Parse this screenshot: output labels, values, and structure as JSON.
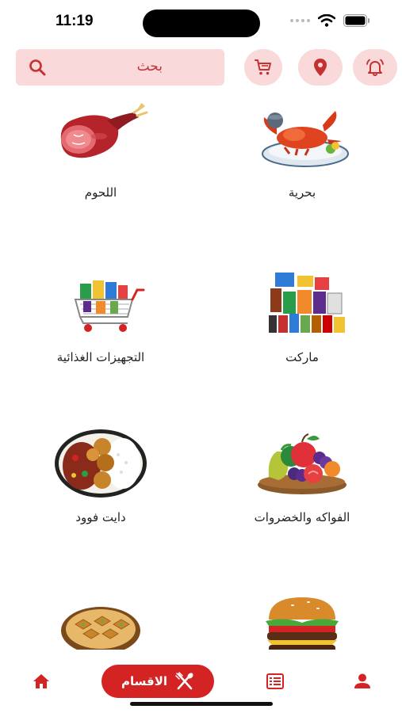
{
  "status_bar": {
    "time": "11:19"
  },
  "header": {
    "search_placeholder": "بحث",
    "icons": [
      "bell-icon",
      "location-pin-icon",
      "cart-icon",
      "search-icon"
    ]
  },
  "categories": [
    {
      "label": "بحرية",
      "icon": "seafood-image"
    },
    {
      "label": "اللحوم",
      "icon": "meat-image"
    },
    {
      "label": "ماركت",
      "icon": "market-image"
    },
    {
      "label": "التجهيزات الغذائية",
      "icon": "food-supplies-image"
    },
    {
      "label": "الفواكه والخضروات",
      "icon": "fruits-vegetables-image"
    },
    {
      "label": "دايت فوود",
      "icon": "diet-food-image"
    },
    {
      "label": "",
      "icon": "burger-image"
    },
    {
      "label": "",
      "icon": "sweets-image"
    }
  ],
  "bottom_nav": {
    "sections_label": "الاقسام",
    "icons": [
      "home-icon",
      "utensils-icon",
      "orders-list-icon",
      "profile-icon"
    ]
  },
  "colors": {
    "accent": "#d32323",
    "accent_light": "#f9d9d9"
  }
}
